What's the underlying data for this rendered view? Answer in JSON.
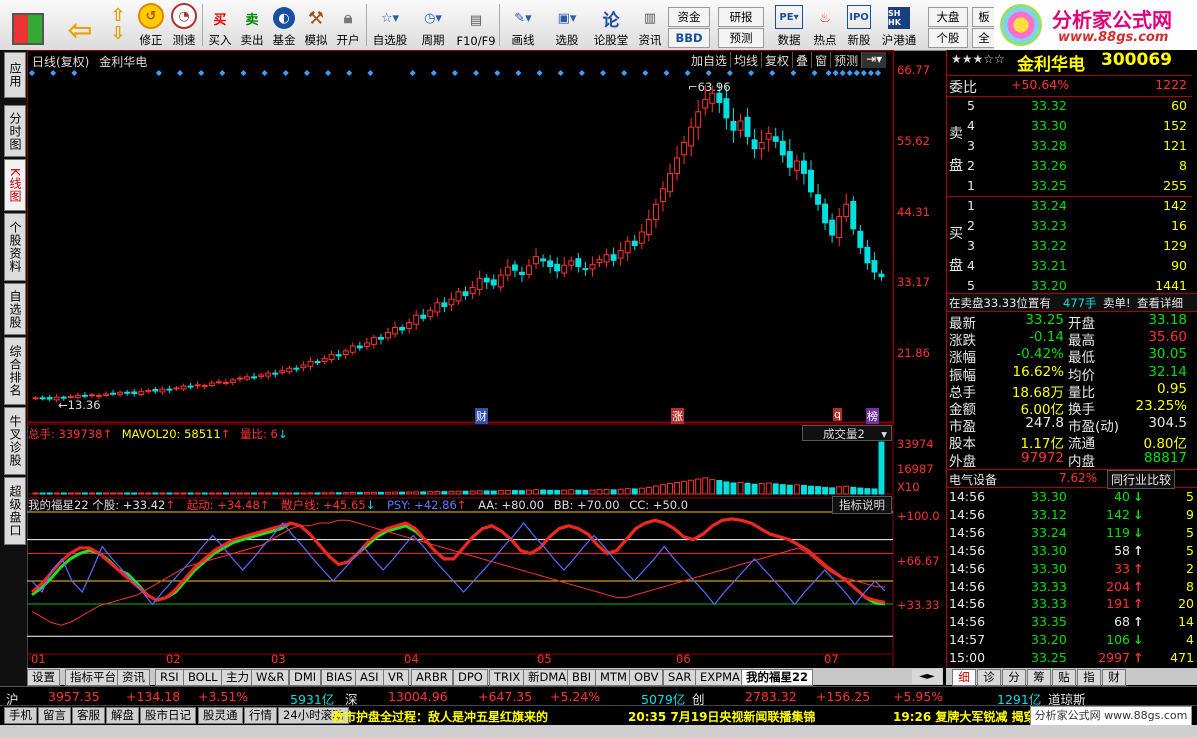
{
  "toolbar": {
    "buttons": [
      {
        "label": "",
        "icon": "windows-logo-icon"
      },
      {
        "label": "",
        "icon": "back-arrow-icon"
      },
      {
        "label": "修正",
        "icon": "updown-arrows-icon"
      },
      {
        "label": "测速",
        "icon": "clock-icon"
      },
      {
        "label": "买入",
        "icon": "buy-icon",
        "glyph": "买"
      },
      {
        "label": "卖出",
        "icon": "sell-icon",
        "glyph": "卖"
      },
      {
        "label": "基金",
        "icon": "fund-icon"
      },
      {
        "label": "模拟",
        "icon": "hammer-icon"
      },
      {
        "label": "开户",
        "icon": "lock-icon"
      },
      {
        "label": "自选股",
        "icon": "star-list-icon"
      },
      {
        "label": "周期",
        "icon": "period-icon"
      },
      {
        "label": "F10/F9",
        "icon": "document-icon"
      },
      {
        "label": "画线",
        "icon": "pencil-icon"
      },
      {
        "label": "选股",
        "icon": "monitor-icon"
      },
      {
        "label": "论股堂",
        "icon": "talk-icon",
        "glyph": "论"
      },
      {
        "label": "资讯",
        "icon": "news-icon"
      },
      {
        "label": "数据",
        "icon": "pe-icon"
      },
      {
        "label": "热点",
        "icon": "hot-icon"
      },
      {
        "label": "新股",
        "icon": "ipo-icon"
      },
      {
        "label": "沪港通",
        "icon": "shhk-icon"
      }
    ],
    "small": {
      "zijin": "资金",
      "bbd": "BBD",
      "yanbao": "研报",
      "yuce": "预测",
      "dapan": "大盘",
      "gegu": "个股",
      "ban": "板",
      "quan": "全"
    },
    "brand": {
      "title": "分析家公式网",
      "url": "www.88gs.com"
    }
  },
  "left_tabs": [
    "应用",
    "分时图",
    "K线图",
    "个股资料",
    "自选股",
    "综合排名",
    "牛叉诊股",
    "超级盘口"
  ],
  "chart": {
    "title": "日线(复权)",
    "stock": "金利华电",
    "top_buttons": [
      "加自选",
      "均线",
      "复权",
      "叠",
      "窗",
      "预测"
    ],
    "ylabels": [
      "66.77",
      "55.62",
      "44.31",
      "33.17",
      "21.86"
    ],
    "high_label": "63.96",
    "low_label": "13.36",
    "event_labels": [
      "财",
      "涨",
      "q",
      "榜"
    ],
    "vol_header": {
      "total": "总手: 339738",
      "mavol": "MAVOL20: 58511",
      "ratio": "量比: 6"
    },
    "vol_dropdown": "成交量2",
    "vol_ylabels": [
      "33974",
      "16987",
      "X10"
    ],
    "ind_header": {
      "name": "我的福星22 个股: +33.42",
      "qidong": "起动: +34.48",
      "sanhu": "散户线: +45.65",
      "psy": "PSY: +42.86",
      "aa": "AA: +80.00",
      "bb": "BB: +70.00",
      "cc": "CC: +50.0"
    },
    "ind_button": "指标说明",
    "ind_ylabels": [
      "+100.0",
      "+66.67",
      "+33.33"
    ],
    "months": [
      "01",
      "02",
      "03",
      "04",
      "05",
      "06",
      "07"
    ]
  },
  "chart_data": {
    "type": "candlestick",
    "high": 63.96,
    "low": 13.36,
    "ylim": [
      10,
      66.77
    ],
    "closes": [
      13.6,
      13.5,
      13.4,
      13.7,
      13.6,
      13.8,
      14.0,
      13.9,
      14.1,
      14.0,
      14.2,
      14.3,
      14.5,
      14.4,
      14.3,
      14.6,
      14.8,
      14.7,
      15.0,
      14.9,
      15.2,
      15.5,
      15.4,
      15.7,
      15.6,
      16.0,
      16.2,
      16.1,
      16.5,
      16.8,
      17.0,
      16.9,
      17.3,
      17.6,
      17.5,
      18.0,
      18.4,
      18.3,
      18.9,
      19.5,
      19.3,
      20.0,
      20.6,
      20.4,
      21.2,
      22.0,
      21.7,
      22.5,
      23.4,
      23.1,
      24.2,
      25.0,
      24.6,
      25.8,
      27.0,
      26.5,
      27.8,
      29.0,
      28.4,
      29.6,
      30.8,
      30.2,
      31.5,
      33.0,
      32.4,
      31.9,
      33.5,
      34.8,
      34.3,
      33.6,
      35.0,
      36.5,
      35.8,
      34.9,
      34.2,
      35.1,
      35.8,
      34.9,
      34.5,
      35.2,
      36.0,
      36.8,
      35.9,
      37.5,
      39.0,
      38.3,
      40.5,
      42.5,
      45.0,
      47.5,
      50.0,
      52.5,
      55.0,
      57.5,
      60.0,
      62.0,
      63.0,
      61.5,
      59.0,
      57.0,
      58.5,
      56.0,
      54.0,
      55.0,
      56.5,
      55.2,
      53.0,
      51.0,
      52.0,
      50.0,
      47.0,
      45.0,
      42.0,
      40.0,
      43.0,
      45.0,
      41.0,
      38.0,
      35.5,
      34.0,
      33.25
    ],
    "volumes": [
      200,
      180,
      220,
      210,
      190,
      230,
      250,
      240,
      260,
      230,
      270,
      280,
      300,
      290,
      260,
      310,
      330,
      300,
      350,
      320,
      360,
      390,
      370,
      400,
      380,
      420,
      450,
      430,
      480,
      510,
      530,
      500,
      560,
      590,
      560,
      620,
      660,
      640,
      700,
      760,
      720,
      800,
      860,
      820,
      900,
      980,
      950,
      1020,
      1100,
      1060,
      1150,
      1250,
      1200,
      1300,
      1420,
      1380,
      1500,
      1650,
      1580,
      1700,
      1850,
      1780,
      1900,
      2100,
      2000,
      1950,
      2200,
      2400,
      2300,
      2150,
      2500,
      2800,
      2600,
      2400,
      2300,
      2500,
      2700,
      2450,
      2350,
      2550,
      2800,
      3000,
      2700,
      3200,
      3500,
      3300,
      3800,
      4200,
      5200,
      6100,
      6800,
      7500,
      8300,
      9000,
      9800,
      10500,
      9400,
      8800,
      7900,
      7200,
      7600,
      7000,
      6400,
      6800,
      7200,
      6600,
      6100,
      5700,
      6000,
      5600,
      5100,
      4800,
      4300,
      4000,
      4700,
      5100,
      4400,
      3900,
      3500,
      3300,
      33974
    ],
    "series": [
      {
        "name": "个股",
        "values": [
          40,
          45,
          52,
          60,
          66,
          70,
          72,
          70,
          65,
          58,
          55,
          48,
          40,
          36,
          38,
          42,
          50,
          58,
          64,
          70,
          74,
          78,
          80,
          82,
          84,
          86,
          88,
          92,
          90,
          84,
          76,
          68,
          62,
          64,
          70,
          76,
          82,
          86,
          88,
          90,
          86,
          80,
          72,
          66,
          66,
          74,
          82,
          88,
          90,
          86,
          80,
          72,
          70,
          74,
          82,
          88,
          90,
          88,
          84,
          76,
          70,
          72,
          80,
          88,
          92,
          94,
          92,
          88,
          82,
          80,
          84,
          90,
          94,
          95,
          94,
          92,
          88,
          84,
          82,
          80,
          76,
          72,
          66,
          60,
          55,
          50,
          44,
          38,
          34,
          33.42
        ]
      },
      {
        "name": "起动",
        "values": [
          42,
          48,
          56,
          64,
          70,
          74,
          74,
          70,
          64,
          58,
          52,
          46,
          40,
          36,
          38,
          44,
          52,
          60,
          66,
          72,
          76,
          80,
          82,
          84,
          86,
          88,
          90,
          92,
          90,
          84,
          76,
          68,
          62,
          64,
          70,
          78,
          84,
          88,
          90,
          92,
          88,
          80,
          72,
          66,
          66,
          74,
          82,
          88,
          90,
          86,
          80,
          72,
          70,
          74,
          82,
          88,
          90,
          88,
          84,
          76,
          70,
          72,
          80,
          88,
          92,
          94,
          92,
          88,
          82,
          80,
          84,
          90,
          94,
          95,
          94,
          92,
          88,
          84,
          82,
          80,
          76,
          72,
          66,
          60,
          55,
          50,
          44,
          38,
          36,
          34.48
        ]
      },
      {
        "name": "散户线",
        "values": [
          28,
          24,
          20,
          18,
          20,
          24,
          28,
          32,
          34,
          36,
          38,
          40,
          44,
          48,
          52,
          56,
          60,
          62,
          64,
          66,
          68,
          70,
          72,
          74,
          76,
          80,
          84,
          88,
          90,
          90,
          92,
          92,
          94,
          94,
          92,
          90,
          88,
          86,
          84,
          82,
          80,
          78,
          76,
          74,
          72,
          70,
          68,
          66,
          64,
          62,
          60,
          58,
          56,
          54,
          52,
          50,
          48,
          46,
          44,
          42,
          40,
          38,
          38,
          40,
          42,
          44,
          46,
          48,
          50,
          52,
          54,
          56,
          58,
          60,
          62,
          64,
          66,
          68,
          70,
          72,
          74,
          70,
          64,
          58,
          54,
          52,
          50,
          48,
          46,
          45.65
        ]
      },
      {
        "name": "PSY",
        "values": [
          50,
          42,
          58,
          66,
          50,
          42,
          58,
          75,
          66,
          58,
          50,
          42,
          33,
          42,
          50,
          58,
          66,
          75,
          83,
          75,
          66,
          58,
          66,
          75,
          83,
          92,
          83,
          75,
          66,
          58,
          50,
          58,
          66,
          75,
          66,
          58,
          66,
          75,
          83,
          75,
          66,
          58,
          50,
          42,
          50,
          58,
          66,
          75,
          83,
          92,
          83,
          75,
          66,
          58,
          66,
          75,
          83,
          75,
          66,
          58,
          50,
          58,
          66,
          75,
          66,
          58,
          50,
          42,
          33,
          42,
          50,
          58,
          66,
          58,
          50,
          42,
          33,
          42,
          50,
          58,
          50,
          42,
          33,
          42,
          50,
          42.86
        ]
      }
    ],
    "ref_lines": {
      "AA": 80,
      "BB": 70,
      "CC": 50
    }
  },
  "quote": {
    "stars": "★★★☆☆",
    "name": "金利华电",
    "code": "300069",
    "weibi_label": "委比",
    "weibi": "+50.64%",
    "weicha": "1222",
    "sell_label": "卖盘",
    "buy_label": "买盘",
    "sell": [
      {
        "n": "5",
        "p": "33.32",
        "v": "60"
      },
      {
        "n": "4",
        "p": "33.30",
        "v": "152"
      },
      {
        "n": "3",
        "p": "33.28",
        "v": "121"
      },
      {
        "n": "2",
        "p": "33.26",
        "v": "8"
      },
      {
        "n": "1",
        "p": "33.25",
        "v": "255"
      }
    ],
    "buy": [
      {
        "n": "1",
        "p": "33.24",
        "v": "142"
      },
      {
        "n": "2",
        "p": "33.23",
        "v": "16"
      },
      {
        "n": "3",
        "p": "33.22",
        "v": "129"
      },
      {
        "n": "4",
        "p": "33.21",
        "v": "90"
      },
      {
        "n": "5",
        "p": "33.20",
        "v": "1441"
      }
    ],
    "notice": {
      "a": "在卖盘33.33位置有",
      "b": "477手",
      "c": "卖单!",
      "d": "查看详细"
    },
    "stats": [
      {
        "l1": "最新",
        "v1": "33.25",
        "c1": "green",
        "l2": "开盘",
        "v2": "33.18",
        "c2": "green"
      },
      {
        "l1": "涨跌",
        "v1": "-0.14",
        "c1": "green",
        "l2": "最高",
        "v2": "35.60",
        "c2": "red"
      },
      {
        "l1": "涨幅",
        "v1": "-0.42%",
        "c1": "green",
        "l2": "最低",
        "v2": "30.05",
        "c2": "green"
      },
      {
        "l1": "振幅",
        "v1": "16.62%",
        "c1": "yellow",
        "l2": "均价",
        "v2": "32.14",
        "c2": "green"
      },
      {
        "l1": "总手",
        "v1": "18.68万",
        "c1": "yellow",
        "l2": "量比",
        "v2": "0.95",
        "c2": "yellow"
      },
      {
        "l1": "金额",
        "v1": "6.00亿",
        "c1": "yellow",
        "l2": "换手",
        "v2": "23.25%",
        "c2": "yellow"
      },
      {
        "l1": "市盈",
        "v1": "247.8",
        "c1": "white",
        "l2": "市盈(动)",
        "v2": "304.5",
        "c2": "white"
      },
      {
        "l1": "股本",
        "v1": "1.17亿",
        "c1": "yellow",
        "l2": "流通",
        "v2": "0.80亿",
        "c2": "yellow"
      },
      {
        "l1": "外盘",
        "v1": "97972",
        "c1": "red",
        "l2": "内盘",
        "v2": "88817",
        "c2": "green"
      }
    ],
    "industry": {
      "name": "电气设备",
      "pct": "7.62%",
      "btn": "同行业比较"
    },
    "ticks": [
      {
        "t": "14:56",
        "p": "33.30",
        "v": "40",
        "d": "down"
      },
      {
        "t": "14:56",
        "p": "33.12",
        "v": "142",
        "d": "down"
      },
      {
        "t": "14:56",
        "p": "33.24",
        "v": "119",
        "d": "down"
      },
      {
        "t": "14:56",
        "p": "33.30",
        "v": "58",
        "d": "up-white"
      },
      {
        "t": "14:56",
        "p": "33.30",
        "v": "33",
        "d": "up"
      },
      {
        "t": "14:56",
        "p": "33.33",
        "v": "204",
        "d": "up"
      },
      {
        "t": "14:56",
        "p": "33.33",
        "v": "191",
        "d": "up"
      },
      {
        "t": "14:56",
        "p": "33.35",
        "v": "68",
        "d": "up-white"
      },
      {
        "t": "14:57",
        "p": "33.20",
        "v": "106",
        "d": "down"
      },
      {
        "t": "15:00",
        "p": "33.25",
        "v": "2997",
        "d": "up"
      }
    ],
    "tick_right": [
      "5",
      "9",
      "5",
      "5",
      "2",
      "8",
      "20",
      "14",
      "4",
      "471"
    ]
  },
  "bottom_tabs": [
    "设置",
    "指标平台",
    "资讯",
    "RSI",
    "BOLL",
    "主力",
    "W&R",
    "DMI",
    "BIAS",
    "ASI",
    "VR",
    "ARBR",
    "DPO",
    "TRIX",
    "新DMA",
    "BBI",
    "MTM",
    "OBV",
    "SAR",
    "EXPMA",
    "我的福星22"
  ],
  "right_tabs": [
    "细",
    "诊",
    "分",
    "筹",
    "贴",
    "指",
    "财"
  ],
  "status": {
    "sh": "沪",
    "sh_idx": "3957.35",
    "sh_chg": "+134.18",
    "sh_pct": "+3.51%",
    "sh_amt": "5931亿",
    "sz": "深",
    "sz_idx": "13004.96",
    "sz_chg": "+647.35",
    "sz_pct": "+5.24%",
    "sz_amt": "5079亿",
    "cy": "创",
    "cy_idx": "2783.32",
    "cy_chg": "+156.25",
    "cy_pct": "+5.95%",
    "cy_amt": "1291亿",
    "dj": "道琼斯"
  },
  "news": {
    "tabs": [
      "手机",
      "留言",
      "客服",
      "解盘",
      "股市日记",
      "股灵通",
      "行情",
      "24小时滚动"
    ],
    "n1": "救市护盘全过程：敌人是冲五星红旗来的",
    "n2": "20:35 7月19日央视新闻联播集锦",
    "n3": "19:26 复牌大军锐减 揭穿"
  },
  "colors": {
    "up": "#ff3232",
    "down": "#00e0e0",
    "bg": "#000000",
    "grid": "#8a0000"
  }
}
